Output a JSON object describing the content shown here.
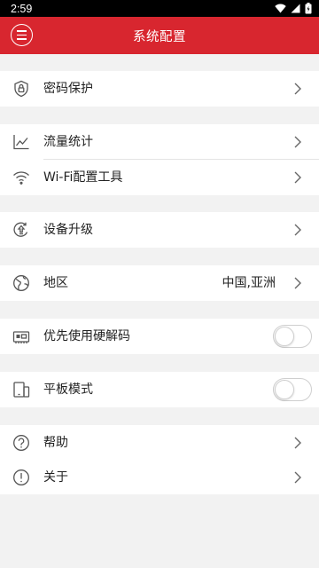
{
  "status_bar": {
    "time": "2:59"
  },
  "header": {
    "title": "系统配置",
    "menu_icon": "menu-icon"
  },
  "items": {
    "password": {
      "label": "密码保护",
      "icon": "shield-lock-icon"
    },
    "traffic": {
      "label": "流量统计",
      "icon": "line-chart-icon"
    },
    "wifi_tool": {
      "label": "Wi-Fi配置工具",
      "icon": "wifi-icon"
    },
    "upgrade": {
      "label": "设备升级",
      "icon": "upgrade-icon"
    },
    "region": {
      "label": "地区",
      "value": "中国,亚洲",
      "icon": "globe-icon"
    },
    "hw_decode": {
      "label": "优先使用硬解码",
      "icon": "chip-icon",
      "enabled": false
    },
    "tablet": {
      "label": "平板模式",
      "icon": "tablet-icon",
      "enabled": false
    },
    "help": {
      "label": "帮助",
      "icon": "help-icon"
    },
    "about": {
      "label": "关于",
      "icon": "info-icon"
    }
  },
  "colors": {
    "accent": "#d8262f",
    "background": "#f2f2f2",
    "icon": "#555555"
  }
}
